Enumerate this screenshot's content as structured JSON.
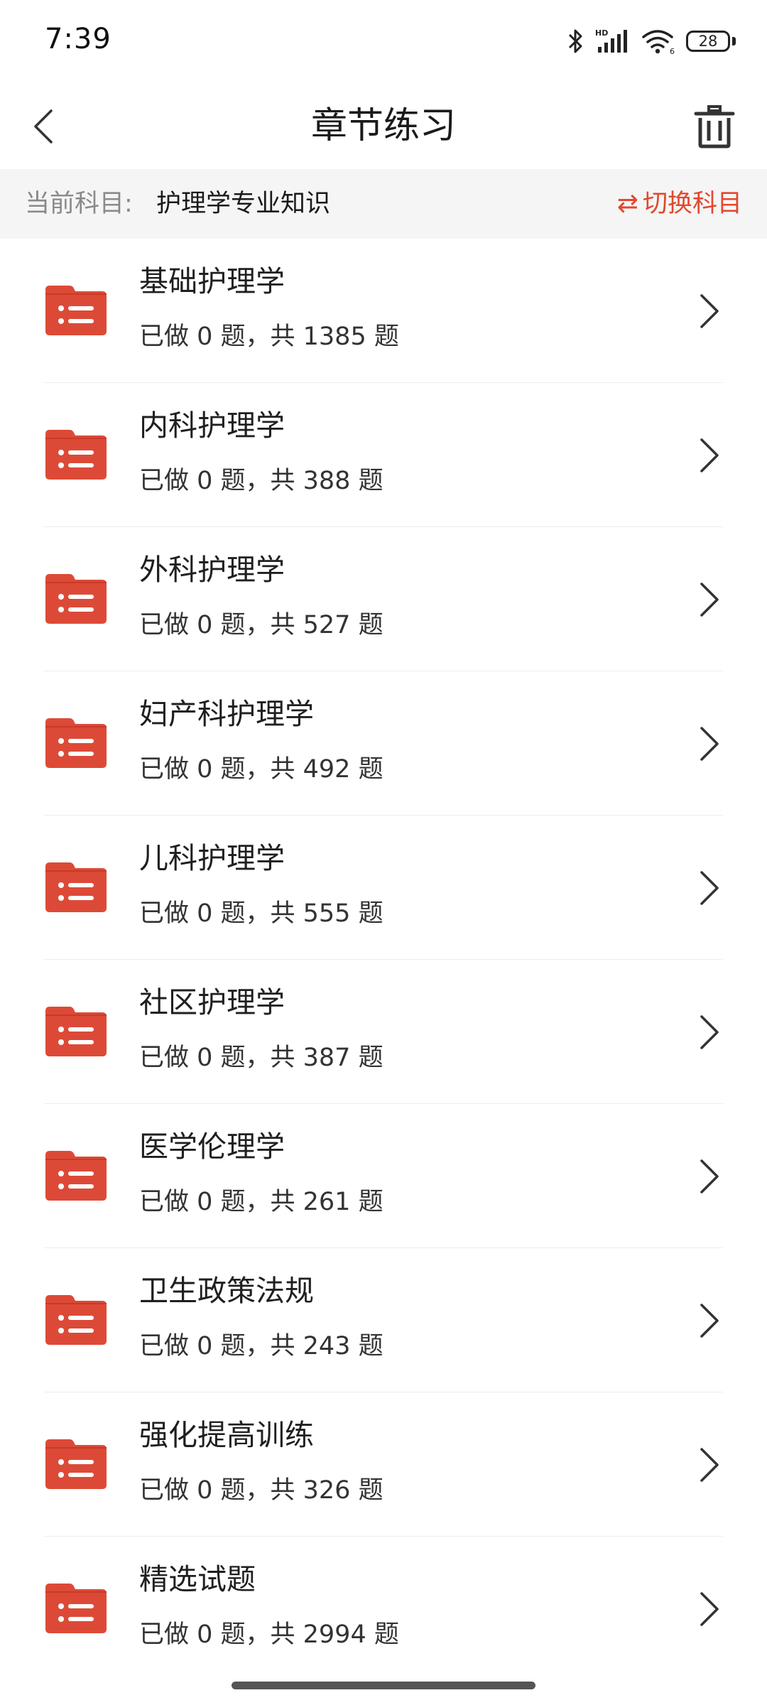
{
  "status_bar": {
    "time": "7:39",
    "battery": "28",
    "icons": [
      "bluetooth-icon",
      "signal-icon",
      "wifi-icon",
      "battery-icon"
    ]
  },
  "header": {
    "title": "章节练习",
    "back_icon": "chevron-left-icon",
    "delete_icon": "trash-icon"
  },
  "subject": {
    "label": "当前科目:",
    "value": "护理学专业知识",
    "switch_icon": "⇄",
    "switch_label": "切换科目"
  },
  "chapters": [
    {
      "title": "基础护理学",
      "progress": "已做 0 题，共 1385 题",
      "done": 0,
      "total": 1385
    },
    {
      "title": "内科护理学",
      "progress": "已做 0 题，共 388 题",
      "done": 0,
      "total": 388
    },
    {
      "title": "外科护理学",
      "progress": "已做 0 题，共 527 题",
      "done": 0,
      "total": 527
    },
    {
      "title": "妇产科护理学",
      "progress": "已做 0 题，共 492 题",
      "done": 0,
      "total": 492
    },
    {
      "title": "儿科护理学",
      "progress": "已做 0 题，共 555 题",
      "done": 0,
      "total": 555
    },
    {
      "title": "社区护理学",
      "progress": "已做 0 题，共 387 题",
      "done": 0,
      "total": 387
    },
    {
      "title": "医学伦理学",
      "progress": "已做 0 题，共 261 题",
      "done": 0,
      "total": 261
    },
    {
      "title": "卫生政策法规",
      "progress": "已做 0 题，共 243 题",
      "done": 0,
      "total": 243
    },
    {
      "title": "强化提高训练",
      "progress": "已做 0 题，共 326 题",
      "done": 0,
      "total": 326
    },
    {
      "title": "精选试题",
      "progress": "已做 0 题，共 2994 题",
      "done": 0,
      "total": 2994
    }
  ],
  "colors": {
    "accent": "#e2482e",
    "folder": "#dc4a37",
    "folder_tab": "#c63a28"
  }
}
